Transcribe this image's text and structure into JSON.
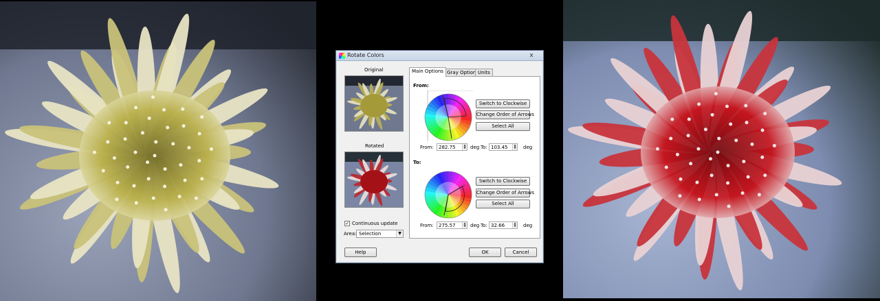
{
  "dialog": {
    "title": "Rotate Colors",
    "close_glyph": "x",
    "original_label": "Original",
    "rotated_label": "Rotated",
    "tabs": [
      {
        "label": "Main Options",
        "active": true
      },
      {
        "label": "Gray Options",
        "active": false
      },
      {
        "label": "Units",
        "active": false
      }
    ],
    "from_section": {
      "heading": "From:",
      "buttons": [
        "Switch to Clockwise",
        "Change Order of Arrows",
        "Select All"
      ],
      "from_label": "From:",
      "from_value": "282.75",
      "unit1": "deg",
      "to_label": "To:",
      "to_value": "103.45",
      "unit2": "deg"
    },
    "to_section": {
      "heading": "To:",
      "buttons": [
        "Switch to Clockwise",
        "Change Order of Arrows",
        "Select All"
      ],
      "from_label": "From:",
      "from_value": "275.57",
      "unit1": "deg",
      "to_label": "To:",
      "to_value": "32.66",
      "unit2": "deg"
    },
    "continuous_update": {
      "label": "Continuous update",
      "checked": true,
      "mark": "✓"
    },
    "area": {
      "label": "Area:",
      "value": "Selection",
      "arrow": "▼"
    },
    "buttons": {
      "help": "Help",
      "ok": "OK",
      "cancel": "Cancel"
    }
  },
  "colors": {
    "original_flower": "#b5ae45",
    "rotated_flower": "#b3121a",
    "background_left": "#8a93a6",
    "background_right": "#9aa6c2"
  }
}
